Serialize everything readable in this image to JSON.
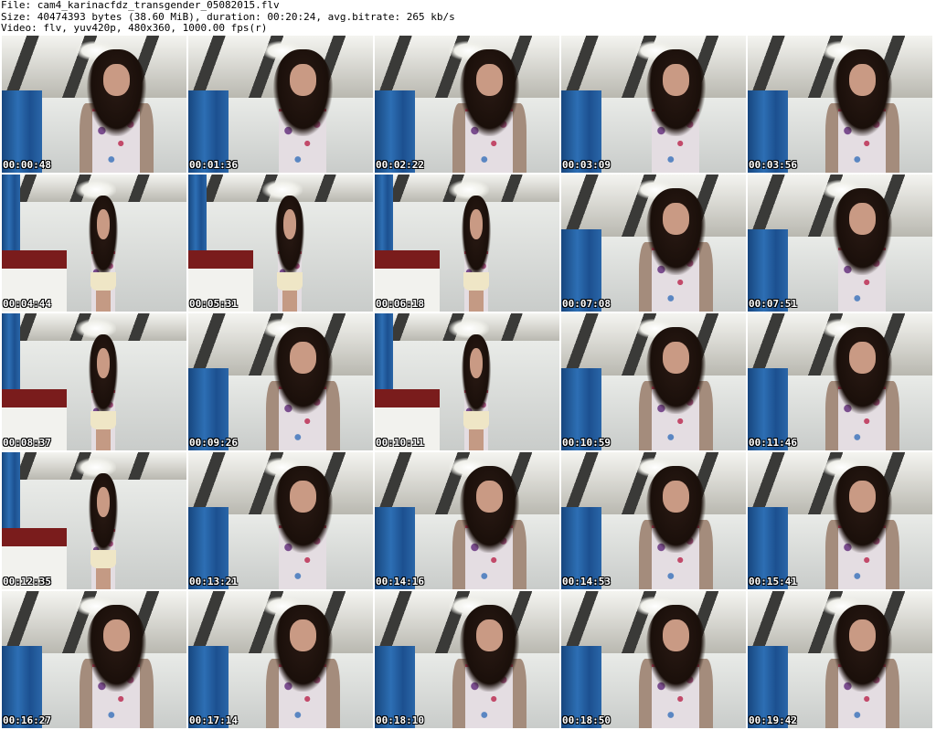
{
  "header": {
    "file_line": "File: cam4_karinacfdz_transgender_05082015.flv",
    "size_line": "Size: 40474393 bytes (38.60 MiB), duration: 00:20:24, avg.bitrate: 265 kb/s",
    "video_line": "Video: flv, yuv420p, 480x360, 1000.00 fps(r)"
  },
  "thumbnails": [
    {
      "time": "00:00:48",
      "scene": "close"
    },
    {
      "time": "00:01:36",
      "scene": "room"
    },
    {
      "time": "00:02:22",
      "scene": "close"
    },
    {
      "time": "00:03:09",
      "scene": "room"
    },
    {
      "time": "00:03:56",
      "scene": "close"
    },
    {
      "time": "00:04:44",
      "scene": "full"
    },
    {
      "time": "00:05:31",
      "scene": "full"
    },
    {
      "time": "00:06:18",
      "scene": "full"
    },
    {
      "time": "00:07:08",
      "scene": "close"
    },
    {
      "time": "00:07:51",
      "scene": "room"
    },
    {
      "time": "00:08:37",
      "scene": "full"
    },
    {
      "time": "00:09:26",
      "scene": "close"
    },
    {
      "time": "00:10:11",
      "scene": "full"
    },
    {
      "time": "00:10:59",
      "scene": "close"
    },
    {
      "time": "00:11:46",
      "scene": "close"
    },
    {
      "time": "00:12:35",
      "scene": "full"
    },
    {
      "time": "00:13:21",
      "scene": "room"
    },
    {
      "time": "00:14:16",
      "scene": "close"
    },
    {
      "time": "00:14:53",
      "scene": "close"
    },
    {
      "time": "00:15:41",
      "scene": "close"
    },
    {
      "time": "00:16:27",
      "scene": "close"
    },
    {
      "time": "00:17:14",
      "scene": "close"
    },
    {
      "time": "00:18:10",
      "scene": "close"
    },
    {
      "time": "00:18:50",
      "scene": "close"
    },
    {
      "time": "00:19:42",
      "scene": "close"
    }
  ]
}
